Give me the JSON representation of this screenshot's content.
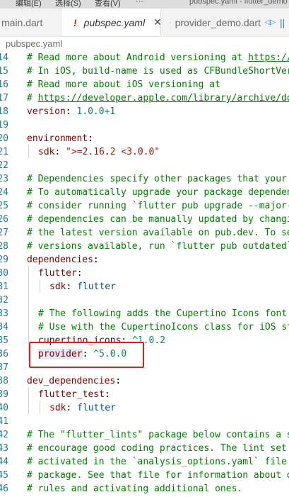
{
  "menubar": {
    "items": [
      "编辑(E)",
      "选择(S)",
      "查看(V)",
      "···"
    ],
    "title": "pubspec.yaml - flutter_demo"
  },
  "tabs": [
    {
      "label": "main.dart",
      "active": false
    },
    {
      "label": "pubspec.yaml",
      "active": true,
      "icon": "warning-icon",
      "icon_glyph": "!",
      "close": "✕"
    },
    {
      "label": "provider_demo.dart",
      "active": false,
      "icon": "provider-icon"
    }
  ],
  "tab_actions": {
    "split": "◁▷",
    "pause": "||"
  },
  "breadcrumb": "pubspec.yaml",
  "colors": {
    "highlight_box": "#e0201b",
    "comment": "#008000",
    "key": "#800000",
    "string": "#a31515",
    "number": "#098658",
    "value": "#0451a5"
  },
  "lines": [
    {
      "n": "14",
      "t": "# Read more about Android versioning at https://developer.android.com/studio/publish/versioning"
    },
    {
      "n": "15",
      "t": "# In iOS, build-name is used as CFBundleShortVersionString"
    },
    {
      "n": "16",
      "t": "# Read more about iOS versioning at"
    },
    {
      "n": "17",
      "t": "# https://developer.apple.com/library/archive/documentation"
    },
    {
      "n": "18",
      "k": "version",
      "v": "1.0.0+1"
    },
    {
      "n": "19",
      "t": ""
    },
    {
      "n": "20",
      "k": "environment"
    },
    {
      "n": "21",
      "k": "sdk",
      "v": "\">=2.16.2 <3.0.0\""
    },
    {
      "n": "22",
      "t": ""
    },
    {
      "n": "23",
      "t": "# Dependencies specify other packages that your package needs"
    },
    {
      "n": "24",
      "t": "# To automatically upgrade your package dependencies"
    },
    {
      "n": "25",
      "t": "# consider running `flutter pub upgrade --major-versions`"
    },
    {
      "n": "26",
      "t": "# dependencies can be manually updated by changing the version"
    },
    {
      "n": "27",
      "t": "# the latest version available on pub.dev. To see which"
    },
    {
      "n": "28",
      "t": "# versions available, run `flutter pub outdated`."
    },
    {
      "n": "29",
      "k": "dependencies"
    },
    {
      "n": "30",
      "k": "flutter"
    },
    {
      "n": "31",
      "k": "sdk",
      "v": "flutter"
    },
    {
      "n": "32",
      "t": ""
    },
    {
      "n": "33",
      "t": "# The following adds the Cupertino Icons font to your application."
    },
    {
      "n": "34",
      "t": "# Use with the CupertinoIcons class for iOS style icons."
    },
    {
      "n": "35",
      "k": "cupertino_icons",
      "v": "^1.0.2"
    },
    {
      "n": "36",
      "k": "provider",
      "v": "^5.0.0"
    },
    {
      "n": "37",
      "t": ""
    },
    {
      "n": "38",
      "k": "dev_dependencies"
    },
    {
      "n": "39",
      "k": "flutter_test"
    },
    {
      "n": "40",
      "k": "sdk",
      "v": "flutter"
    },
    {
      "n": "41",
      "t": ""
    },
    {
      "n": "42",
      "t": "# The \"flutter_lints\" package below contains a set of recommended lints"
    },
    {
      "n": "43",
      "t": "# encourage good coding practices. The lint set provided by the"
    },
    {
      "n": "44",
      "t": "# activated in the `analysis_options.yaml` file located at the root"
    },
    {
      "n": "45",
      "t": "# package. See that file for information about deactivating specific"
    },
    {
      "n": "46",
      "t": "# rules and activating additional ones."
    }
  ]
}
